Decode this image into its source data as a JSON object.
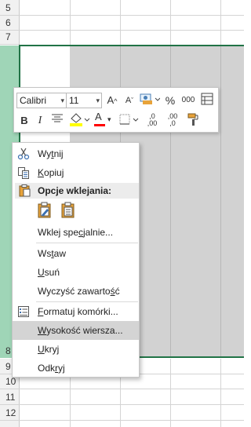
{
  "grid": {
    "row_headers_top": [
      "5",
      "6",
      "7"
    ],
    "row_header_selected": "8",
    "row_headers_bottom": [
      "9",
      "10",
      "11",
      "12"
    ]
  },
  "mini_toolbar": {
    "font_name": "Calibri",
    "font_size": "11",
    "increase_font_label": "A",
    "decrease_font_label": "A",
    "percent_label": "%",
    "thousands_label": "000",
    "bold_label": "B",
    "italic_label": "I",
    "font_color_label": "A",
    "dec_increase_label": ",0 ,00",
    "dec_decrease_label": ",00 ,0",
    "colors": {
      "highlight": "#ffff00",
      "font_color": "#ff0000",
      "accent_green": "#217346"
    }
  },
  "context_menu": {
    "items": [
      {
        "pre": "Wy",
        "key": "t",
        "post": "nij",
        "icon": "scissors-icon"
      },
      {
        "pre": "",
        "key": "K",
        "post": "opiuj",
        "icon": "copy-icon"
      },
      {
        "pre": "",
        "key": "",
        "post": "",
        "icon": ""
      },
      {
        "pre": "Wklej spe",
        "key": "c",
        "post": "jalnie...",
        "icon": ""
      },
      {
        "pre": "Ws",
        "key": "t",
        "post": "aw",
        "icon": ""
      },
      {
        "pre": "",
        "key": "U",
        "post": "suń",
        "icon": ""
      },
      {
        "pre": "Wyczyść zawarto",
        "key": "ś",
        "post": "ć",
        "icon": ""
      },
      {
        "pre": "",
        "key": "F",
        "post": "ormatuj komórki...",
        "icon": "format-cells-icon"
      },
      {
        "pre": "",
        "key": "W",
        "post": "ysokość wiersza...",
        "icon": ""
      },
      {
        "pre": "",
        "key": "U",
        "post": "kryj",
        "icon": ""
      },
      {
        "pre": "Odk",
        "key": "r",
        "post": "yj",
        "icon": ""
      }
    ],
    "paste_section_title": "Opcje wklejania:",
    "paste_option_icons": [
      "paste-formatting-icon",
      "paste-icon"
    ]
  }
}
